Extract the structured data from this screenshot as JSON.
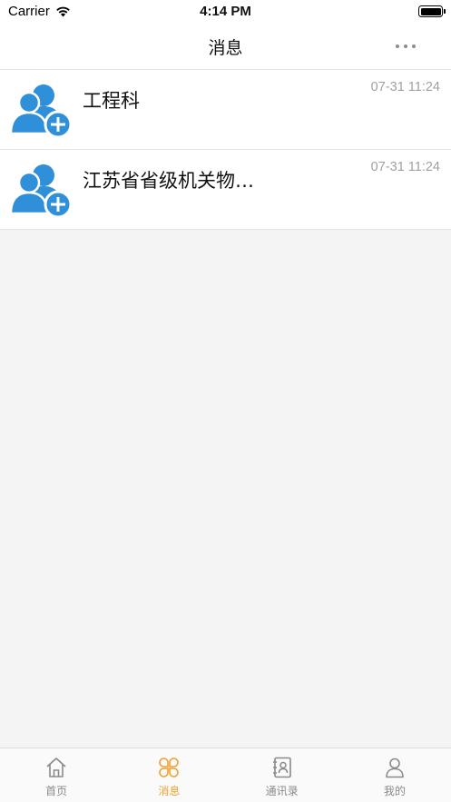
{
  "status_bar": {
    "carrier": "Carrier",
    "time": "4:14 PM"
  },
  "nav": {
    "title": "消息",
    "more_icon": "more-dots-icon"
  },
  "conversations": [
    {
      "name": "工程科",
      "time": "07-31 11:24",
      "icon": "group-add-icon"
    },
    {
      "name": "江苏省省级机关物…",
      "time": "07-31 11:24",
      "icon": "group-add-icon"
    }
  ],
  "tabs": [
    {
      "label": "首页",
      "icon": "home-icon",
      "active": false
    },
    {
      "label": "消息",
      "icon": "message-clover-icon",
      "active": true
    },
    {
      "label": "通讯录",
      "icon": "contacts-book-icon",
      "active": false
    },
    {
      "label": "我的",
      "icon": "person-icon",
      "active": false
    }
  ],
  "colors": {
    "accent": "#f0a030",
    "avatar_blue": "#2f8fd8",
    "inactive_tab": "#8a8a8a",
    "timestamp": "#a0a0a0",
    "background": "#f4f4f4"
  }
}
